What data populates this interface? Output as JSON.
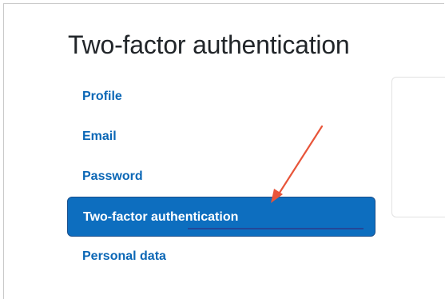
{
  "page": {
    "title": "Two-factor authentication"
  },
  "nav": {
    "items": [
      {
        "label": "Profile",
        "active": false
      },
      {
        "label": "Email",
        "active": false
      },
      {
        "label": "Password",
        "active": false
      },
      {
        "label": "Two-factor authentication",
        "active": true
      },
      {
        "label": "Personal data",
        "active": false
      }
    ]
  },
  "colors": {
    "link": "#0b67b6",
    "active_background": "#0d6ebf",
    "active_text": "#ffffff",
    "annotation_arrow": "#e8553a"
  }
}
